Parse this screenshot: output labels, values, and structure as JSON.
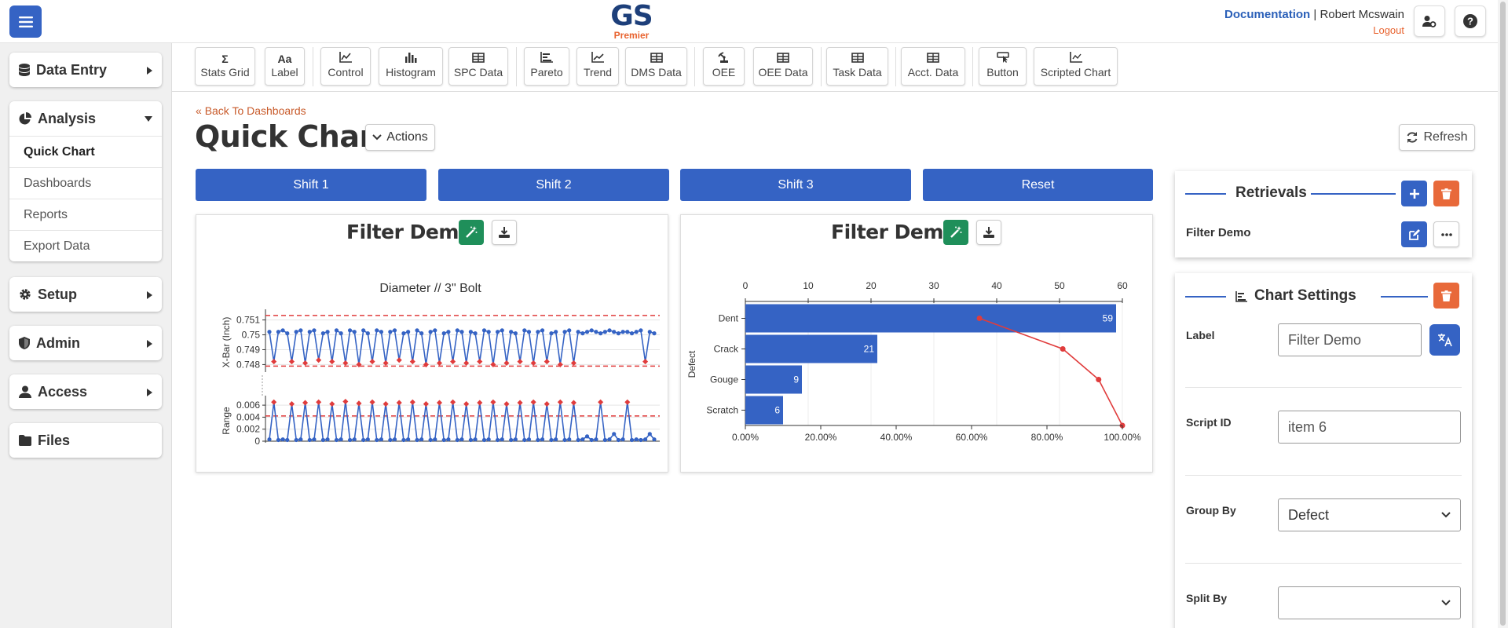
{
  "logo": {
    "main": "GS",
    "sub": "Premier"
  },
  "user": {
    "documentation": "Documentation",
    "separator": "|",
    "name": "Robert Mcswain",
    "logout": "Logout"
  },
  "sidebar": {
    "data_entry": "Data Entry",
    "analysis": "Analysis",
    "analysis_items": [
      "Quick Chart",
      "Dashboards",
      "Reports",
      "Export Data"
    ],
    "setup": "Setup",
    "admin": "Admin",
    "access": "Access",
    "files": "Files"
  },
  "toolbar": {
    "tools": [
      {
        "label": "Stats Grid",
        "glyph": "Σ"
      },
      {
        "label": "Label",
        "glyph": "Aa"
      },
      {
        "label": "Control",
        "glyph": "chart-line-icon"
      },
      {
        "label": "Histogram",
        "glyph": "bars-icon"
      },
      {
        "label": "SPC Data",
        "glyph": "table-icon"
      },
      {
        "label": "Pareto",
        "glyph": "bar-horizontal-icon"
      },
      {
        "label": "Trend",
        "glyph": "trend-icon"
      },
      {
        "label": "DMS Data",
        "glyph": "table-icon"
      },
      {
        "label": "OEE",
        "glyph": "robot-arm-icon"
      },
      {
        "label": "OEE Data",
        "glyph": "table-icon"
      },
      {
        "label": "Task Data",
        "glyph": "table-icon"
      },
      {
        "label": "Acct. Data",
        "glyph": "table-icon"
      },
      {
        "label": "Button",
        "glyph": "pointer-icon"
      },
      {
        "label": "Scripted Chart",
        "glyph": "script-chart-icon"
      }
    ]
  },
  "page": {
    "back": "Back To Dashboards",
    "title": "Quick Chart",
    "actions": "Actions",
    "refresh": "Refresh"
  },
  "shifts": [
    "Shift 1",
    "Shift 2",
    "Shift 3",
    "Reset"
  ],
  "panels": [
    {
      "title": "Filter Demo"
    },
    {
      "title": "Filter Demo"
    }
  ],
  "retrievals": {
    "title": "Retrievals",
    "item": "Filter Demo"
  },
  "chart_settings": {
    "title": "Chart Settings",
    "label_label": "Label",
    "label_value": "Filter Demo",
    "script_label": "Script ID",
    "script_value": "item 6",
    "group_label": "Group By",
    "group_value": "Defect",
    "split_label": "Split By",
    "split_value": ""
  },
  "colors": {
    "primary": "#3563c4",
    "accent": "#e8632f",
    "green": "#1f8f5a",
    "limit": "#e03c3c"
  },
  "chart_data": [
    {
      "type": "line",
      "title": "Diameter  //  3\" Bolt",
      "subplots": [
        {
          "ylabel": "X-Bar (Inch)",
          "yticks": [
            "0.751",
            "0.75",
            "0.749",
            "0.748"
          ],
          "ylim": [
            0.7476,
            0.7514
          ],
          "ucl": 0.7513,
          "lcl": 0.7479,
          "values": [
            0.7502,
            0.7482,
            0.7502,
            0.7503,
            0.7501,
            0.7482,
            0.7502,
            0.7503,
            0.7481,
            0.7502,
            0.7503,
            0.7483,
            0.7501,
            0.7502,
            0.7482,
            0.7503,
            0.7501,
            0.7481,
            0.7503,
            0.7502,
            0.748,
            0.7503,
            0.7501,
            0.7482,
            0.7503,
            0.7502,
            0.7481,
            0.7502,
            0.7503,
            0.7483,
            0.7501,
            0.7502,
            0.7482,
            0.7503,
            0.7501,
            0.748,
            0.7502,
            0.7503,
            0.7481,
            0.7501,
            0.7502,
            0.7482,
            0.7503,
            0.7502,
            0.7481,
            0.7502,
            0.7501,
            0.7482,
            0.7503,
            0.7502,
            0.748,
            0.7502,
            0.7503,
            0.7481,
            0.7502,
            0.7501,
            0.7482,
            0.7503,
            0.7502,
            0.7481,
            0.7502,
            0.7503,
            0.7482,
            0.7501,
            0.7502,
            0.748,
            0.7502,
            0.7503,
            0.7481,
            0.7502,
            0.7501,
            0.7502,
            0.7503,
            0.7502,
            0.7501,
            0.7502,
            0.7503,
            0.7502,
            0.7501,
            0.7502,
            0.7502,
            0.7501,
            0.7502,
            0.7503,
            0.7482,
            0.7502,
            0.7501
          ]
        },
        {
          "ylabel": "Range",
          "yticks": [
            "0.006",
            "0.004",
            "0.002",
            "0"
          ],
          "ylim": [
            0,
            0.0068
          ],
          "ucl": 0.0042,
          "lcl": 0,
          "values": [
            0.0003,
            0.0065,
            0.0002,
            0.0003,
            0.0002,
            0.0062,
            0.0002,
            0.0003,
            0.0064,
            0.0002,
            0.0003,
            0.0065,
            0.0002,
            0.0003,
            0.0062,
            0.0002,
            0.0003,
            0.0066,
            0.0002,
            0.0003,
            0.0063,
            0.0002,
            0.0003,
            0.0065,
            0.0002,
            0.0003,
            0.0062,
            0.0002,
            0.0003,
            0.0064,
            0.0002,
            0.0003,
            0.0065,
            0.0002,
            0.0003,
            0.0062,
            0.0002,
            0.0003,
            0.0064,
            0.0002,
            0.0003,
            0.0065,
            0.0002,
            0.0003,
            0.0062,
            0.0002,
            0.0003,
            0.0064,
            0.0002,
            0.0003,
            0.0065,
            0.0002,
            0.0003,
            0.0062,
            0.0002,
            0.0003,
            0.0064,
            0.0002,
            0.0003,
            0.0065,
            0.0002,
            0.0003,
            0.0062,
            0.0002,
            0.0003,
            0.0065,
            0.0002,
            0.0003,
            0.0064,
            0.0002,
            0.0003,
            0.0008,
            0.0002,
            0.0003,
            0.0065,
            0.0002,
            0.0003,
            0.0012,
            0.0002,
            0.0003,
            0.0065,
            0.0002,
            0.0003,
            0.0002,
            0.0003,
            0.0012,
            0.0003
          ]
        }
      ]
    },
    {
      "type": "bar",
      "orientation": "horizontal",
      "ylabel": "Defect",
      "categories": [
        "Dent",
        "Crack",
        "Gouge",
        "Scratch"
      ],
      "values": [
        59,
        21,
        9,
        6
      ],
      "xlim": [
        0,
        60
      ],
      "xticks": [
        "0",
        "10",
        "20",
        "30",
        "40",
        "50",
        "60"
      ],
      "cumulative_pct": [
        62.1,
        84.2,
        93.7,
        100
      ],
      "pct_ticks": [
        "0.00%",
        "20.00%",
        "40.00%",
        "60.00%",
        "80.00%",
        "100.00%"
      ]
    }
  ]
}
